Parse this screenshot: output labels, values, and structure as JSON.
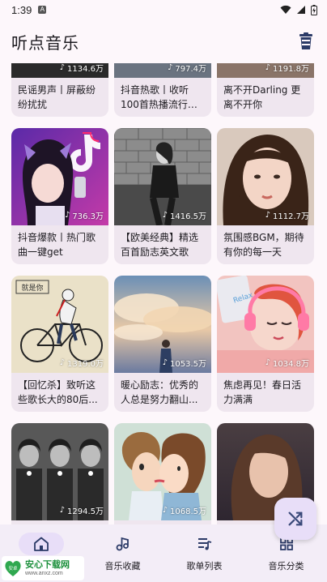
{
  "status_bar": {
    "time": "1:39",
    "sim_label": "A"
  },
  "app_bar": {
    "title": "听点音乐",
    "action_icon": "trash-can-icon"
  },
  "playlists": [
    {
      "title": "民谣男声丨屏蔽纷纷扰扰",
      "play_count": "1134.6万",
      "art": "partial-dark"
    },
    {
      "title": "抖音热歌丨收听100首热播流行单...",
      "play_count": "797.4万",
      "art": "partial-city"
    },
    {
      "title": "离不开Darling 更离不开你",
      "play_count": "1191.8万",
      "art": "partial-room"
    },
    {
      "title": "抖音爆款丨热门歌曲一键get",
      "play_count": "736.3万",
      "art": "purple-girl"
    },
    {
      "title": "【欧美经典】精选百首励志英文歌",
      "play_count": "1416.5万",
      "art": "bw-wall"
    },
    {
      "title": "氛围感BGM，期待有你的每一天",
      "play_count": "1112.7万",
      "art": "portrait-girl"
    },
    {
      "title": "【回忆杀】致听这些歌长大的80后...",
      "play_count": "1319.0万",
      "art": "bicycle-sketch"
    },
    {
      "title": "暖心励志：优秀的人总是努力翻山...",
      "play_count": "1053.5万",
      "art": "cloud-sky"
    },
    {
      "title": "焦虑再见！春日活力满满",
      "play_count": "1034.8万",
      "art": "pink-headphones"
    },
    {
      "title": "",
      "play_count": "1294.5万",
      "art": "bw-couple"
    },
    {
      "title": "",
      "play_count": "1068.5万",
      "art": "cartoon-kiss"
    },
    {
      "title": "",
      "play_count": "",
      "art": "brunette"
    }
  ],
  "fab": {
    "icon": "shuffle-icon"
  },
  "bottom_nav": [
    {
      "label": "",
      "icon": "home-icon",
      "active": true
    },
    {
      "label": "音乐收藏",
      "icon": "music-note-icon",
      "active": false
    },
    {
      "label": "歌单列表",
      "icon": "playlist-icon",
      "active": false
    },
    {
      "label": "音乐分类",
      "icon": "grid-icon",
      "active": false
    }
  ],
  "watermark": {
    "main": "安心下载网",
    "sub": "www.anxz.com",
    "badge": "安卓"
  },
  "colors": {
    "background": "#fdf7fb",
    "card": "#efe6ef",
    "nav": "#f3edf7",
    "accent_container": "#e8def8"
  }
}
